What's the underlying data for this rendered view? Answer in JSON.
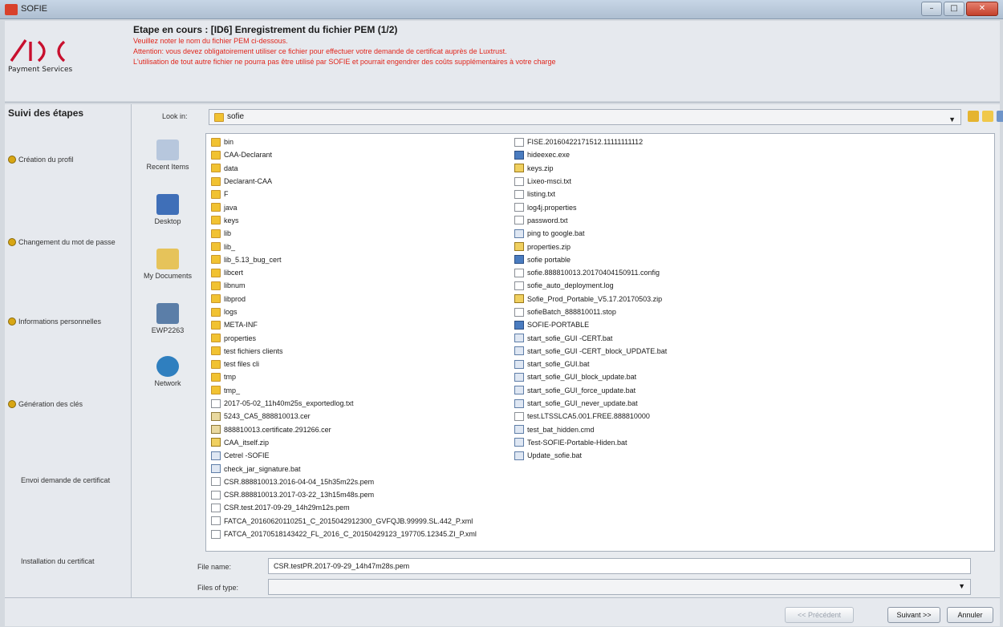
{
  "window": {
    "title": "SOFIE"
  },
  "header": {
    "logo_caption": "Payment Services",
    "step_title": "Etape en cours : [ID6] Enregistrement du fichier PEM (1/2)",
    "warnings": [
      "Veuillez noter le nom du fichier PEM ci-dessous.",
      "Attention: vous devez obligatoirement utiliser ce fichier pour effectuer votre demande de certificat auprès de Luxtrust.",
      "L'utilisation de tout autre fichier ne pourra pas être utilisé par SOFIE et pourrait engendrer des coûts supplémentaires à votre charge"
    ]
  },
  "steps": {
    "title": "Suivi des étapes",
    "items": [
      {
        "label": "Création du profil"
      },
      {
        "label": "Changement du mot de passe"
      },
      {
        "label": "Informations personnelles"
      },
      {
        "label": "Génération des clés"
      },
      {
        "label": "Envoi demande de certificat"
      },
      {
        "label": "Installation du certificat"
      }
    ]
  },
  "chooser": {
    "look_in_label": "Look in:",
    "look_in_value": "sofie",
    "places": [
      {
        "label": "Recent Items"
      },
      {
        "label": "Desktop"
      },
      {
        "label": "My Documents"
      },
      {
        "label": "EWP2263"
      },
      {
        "label": "Network"
      }
    ],
    "col1": [
      {
        "name": "bin",
        "type": "folder"
      },
      {
        "name": "CAA-Declarant",
        "type": "folder"
      },
      {
        "name": "data",
        "type": "folder"
      },
      {
        "name": "Declarant-CAA",
        "type": "folder"
      },
      {
        "name": "F",
        "type": "folder"
      },
      {
        "name": "java",
        "type": "folder"
      },
      {
        "name": "keys",
        "type": "folder"
      },
      {
        "name": "lib",
        "type": "folder"
      },
      {
        "name": "lib_",
        "type": "folder"
      },
      {
        "name": "lib_5.13_bug_cert",
        "type": "folder"
      },
      {
        "name": "libcert",
        "type": "folder"
      },
      {
        "name": "libnum",
        "type": "folder"
      },
      {
        "name": "libprod",
        "type": "folder"
      },
      {
        "name": "logs",
        "type": "folder"
      },
      {
        "name": "META-INF",
        "type": "folder"
      },
      {
        "name": "properties",
        "type": "folder"
      },
      {
        "name": "test fichiers clients",
        "type": "folder"
      },
      {
        "name": "test files cli",
        "type": "folder"
      },
      {
        "name": "tmp",
        "type": "folder"
      },
      {
        "name": "tmp_",
        "type": "folder"
      },
      {
        "name": "2017-05-02_11h40m25s_exportedlog.txt",
        "type": "doc"
      },
      {
        "name": "5243_CA5_888810013.cer",
        "type": "cert"
      },
      {
        "name": "888810013.certificate.291266.cer",
        "type": "cert"
      },
      {
        "name": "CAA_itself.zip",
        "type": "zip"
      },
      {
        "name": "Cetrel -SOFIE",
        "type": "bat"
      },
      {
        "name": "check_jar_signature.bat",
        "type": "bat"
      },
      {
        "name": "CSR.888810013.2016-04-04_15h35m22s.pem",
        "type": "doc"
      },
      {
        "name": "CSR.888810013.2017-03-22_13h15m48s.pem",
        "type": "doc"
      },
      {
        "name": "CSR.test.2017-09-29_14h29m12s.pem",
        "type": "doc"
      },
      {
        "name": "FATCA_20160620110251_C_2015042912300_GVFQJB.99999.SL.442_P.xml",
        "type": "doc"
      },
      {
        "name": "FATCA_20170518143422_FL_2016_C_20150429123_197705.12345.ZI_P.xml",
        "type": "doc"
      }
    ],
    "col2": [
      {
        "name": "FISE.20160422171512.11111111112",
        "type": "doc"
      },
      {
        "name": "hideexec.exe",
        "type": "exe"
      },
      {
        "name": "keys.zip",
        "type": "zip"
      },
      {
        "name": "Lixeo-msci.txt",
        "type": "doc"
      },
      {
        "name": "listing.txt",
        "type": "doc"
      },
      {
        "name": "log4j.properties",
        "type": "doc"
      },
      {
        "name": "password.txt",
        "type": "doc"
      },
      {
        "name": "ping to google.bat",
        "type": "bat"
      },
      {
        "name": "properties.zip",
        "type": "zip"
      },
      {
        "name": "sofie portable",
        "type": "exe"
      },
      {
        "name": "sofie.888810013.20170404150911.config",
        "type": "doc"
      },
      {
        "name": "sofie_auto_deployment.log",
        "type": "doc"
      },
      {
        "name": "Sofie_Prod_Portable_V5.17.20170503.zip",
        "type": "zip"
      },
      {
        "name": "sofieBatch_888810011.stop",
        "type": "doc"
      },
      {
        "name": "SOFIE-PORTABLE",
        "type": "exe"
      },
      {
        "name": "start_sofie_GUI -CERT.bat",
        "type": "bat"
      },
      {
        "name": "start_sofie_GUI -CERT_block_UPDATE.bat",
        "type": "bat"
      },
      {
        "name": "start_sofie_GUI.bat",
        "type": "bat"
      },
      {
        "name": "start_sofie_GUI_block_update.bat",
        "type": "bat"
      },
      {
        "name": "start_sofie_GUI_force_update.bat",
        "type": "bat"
      },
      {
        "name": "start_sofie_GUI_never_update.bat",
        "type": "bat"
      },
      {
        "name": "test.LTSSLCA5.001.FREE.888810000",
        "type": "doc"
      },
      {
        "name": "test_bat_hidden.cmd",
        "type": "bat"
      },
      {
        "name": "Test-SOFIE-Portable-Hiden.bat",
        "type": "bat"
      },
      {
        "name": "Update_sofie.bat",
        "type": "bat"
      }
    ],
    "file_name_label": "File name:",
    "file_name_value": "CSR.testPR.2017-09-29_14h47m28s.pem",
    "file_type_label": "Files of type:",
    "file_type_value": ""
  },
  "footer": {
    "prev_label": "<< Précédent",
    "next_label": "Suivant >>",
    "cancel_label": "Annuler"
  },
  "colors": {
    "warning": "#e0261c",
    "logo": "#c8102e",
    "folder": "#f1c232",
    "step_done": "#d8a614"
  }
}
